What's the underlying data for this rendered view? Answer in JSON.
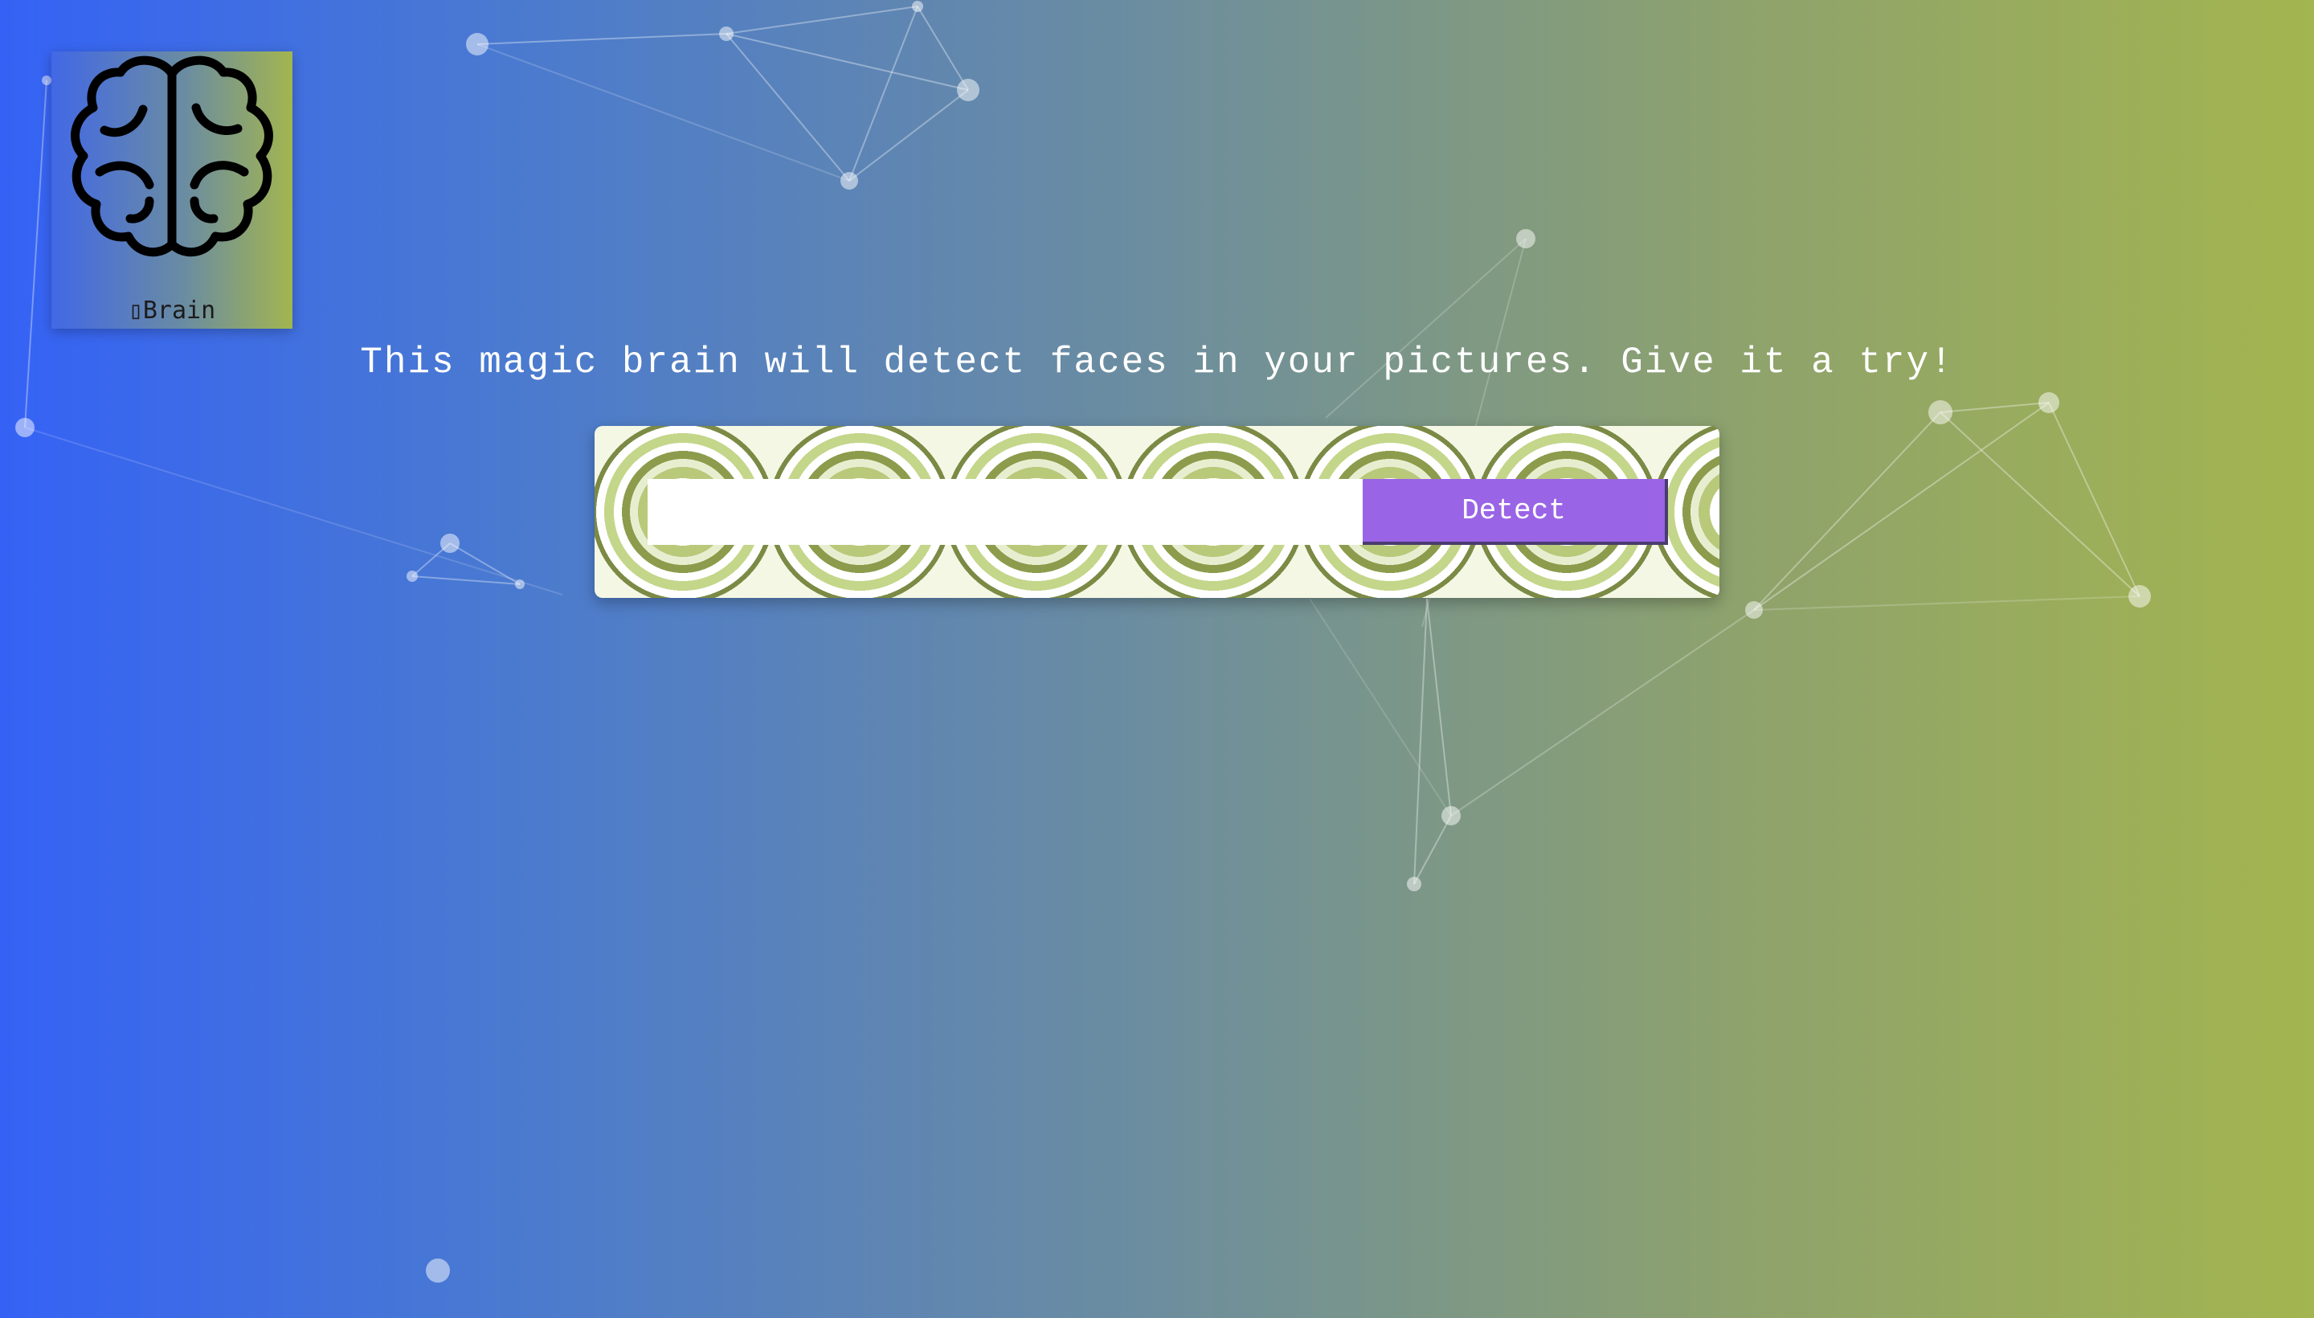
{
  "logo": {
    "icon": "brain-icon",
    "label": "▯Brain"
  },
  "tagline": "This magic brain will detect faces in your pictures. Give it a try!",
  "form": {
    "input_value": "",
    "input_placeholder": "",
    "button_label": "Detect"
  },
  "colors": {
    "gradient_start": "#3562f5",
    "gradient_end": "#a3b54f",
    "button": "#9a64e6"
  }
}
